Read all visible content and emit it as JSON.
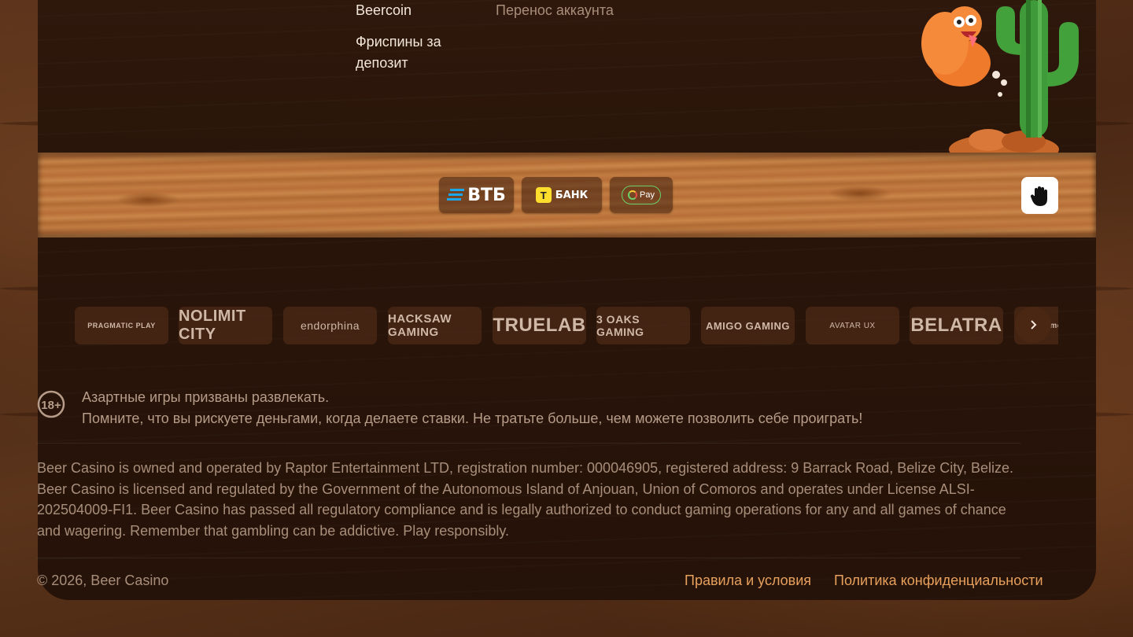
{
  "links": {
    "beercoin": "Beercoin",
    "freespins": "Фриспины за депозит",
    "transfer": "Перенос аккаунта"
  },
  "payments": {
    "vtb": "ВТБ",
    "tbank": "БАНК",
    "tbank_logo": "Т",
    "sbp": "Pay"
  },
  "providers": [
    "PRAGMATIC PLAY",
    "NOLIMIT CITY",
    "endorphina",
    "HACKSAW GAMING",
    "TRUELAB",
    "3 OAKS GAMING",
    "AMIGO GAMING",
    "AVATAR UX",
    "BELATRA",
    "BigTimeGaming"
  ],
  "responsible": {
    "line1": "Азартные игры призваны развлекать.",
    "line2": "Помните, что вы рискуете деньгами, когда делаете ставки. Не тратьте больше, чем можете позволить себе проиграть!",
    "badge": "18+"
  },
  "legal_text": "Beer Casino is owned and operated by Raptor Entertainment LTD, registration number: 000046905, registered address: 9 Barrack Road, Belize City, Belize. Beer Casino is licensed and regulated by the Government of the Autonomous Island of Anjouan, Union of Comoros and operates under License ALSI-202504009-FI1. Beer Casino has passed all regulatory compliance and is legally authorized to conduct gaming operations for any and all games of chance and wagering. Remember that gambling can be addictive. Play responsibly.",
  "footer": {
    "copyright": "© 2026, Beer Casino",
    "terms": "Правила и условия",
    "privacy": "Политика конфиденциальности"
  },
  "colors": {
    "accent_link": "#e8a15d",
    "panel": "#2a150a",
    "plank": "#bb7640"
  }
}
